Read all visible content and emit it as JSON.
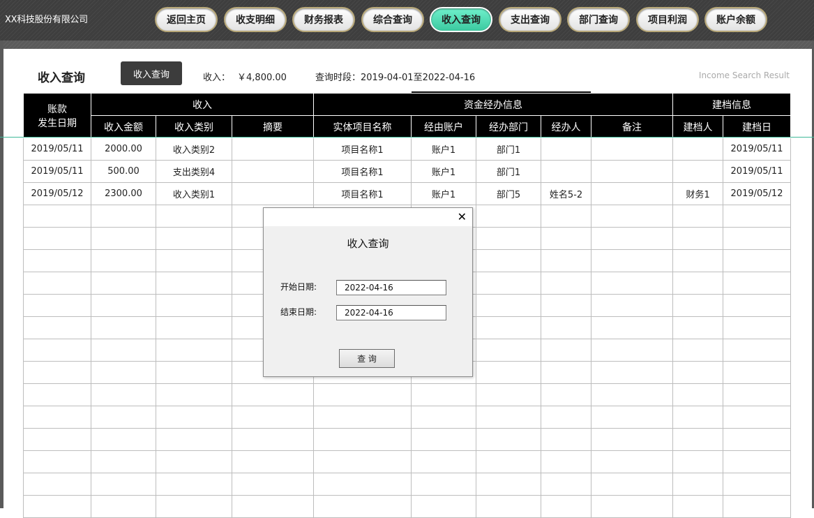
{
  "app": {
    "company_name": "XX科技股份有限公司"
  },
  "nav": {
    "items": [
      {
        "label": "返回主页",
        "active": false
      },
      {
        "label": "收支明细",
        "active": false
      },
      {
        "label": "财务报表",
        "active": false
      },
      {
        "label": "综合查询",
        "active": false
      },
      {
        "label": "收入查询",
        "active": true
      },
      {
        "label": "支出查询",
        "active": false
      },
      {
        "label": "部门查询",
        "active": false
      },
      {
        "label": "项目利润",
        "active": false
      },
      {
        "label": "账户余额",
        "active": false
      }
    ],
    "active_color": "#4fdcb3"
  },
  "header": {
    "title": "收入查询",
    "query_button": "收入查询",
    "income_label": "收入：",
    "income_value": "￥4,800.00",
    "period_label": "查询时段：",
    "period_value": "2019-04-01至2022-04-16",
    "english_caption": "Income Search Result"
  },
  "table": {
    "group_headers": {
      "date": [
        "账款",
        "发生日期"
      ],
      "income": "收入",
      "fund": "资金经办信息",
      "archive": "建档信息"
    },
    "columns": [
      "收入金额",
      "收入类别",
      "摘要",
      "实体项目名称",
      "经由账户",
      "经办部门",
      "经办人",
      "备注",
      "建档人",
      "建档日"
    ],
    "rows": [
      [
        "2019/05/11",
        "2000.00",
        "收入类别2",
        "",
        "项目名称1",
        "账户1",
        "部门1",
        "",
        "",
        "",
        "2019/05/11"
      ],
      [
        "2019/05/11",
        "500.00",
        "支出类别4",
        "",
        "项目名称1",
        "账户1",
        "部门1",
        "",
        "",
        "",
        "2019/05/11"
      ],
      [
        "2019/05/12",
        "2300.00",
        "收入类别1",
        "",
        "项目名称1",
        "账户1",
        "部门5",
        "姓名5-2",
        "",
        "财务1",
        "2019/05/12"
      ]
    ],
    "empty_rows": 14
  },
  "dialog": {
    "close_icon": "close-icon",
    "heading": "收入查询",
    "start_label": "开始日期:",
    "start_value": "2022-04-16",
    "end_label": "结束日期:",
    "end_value": "2022-04-16",
    "submit": "查 询"
  }
}
